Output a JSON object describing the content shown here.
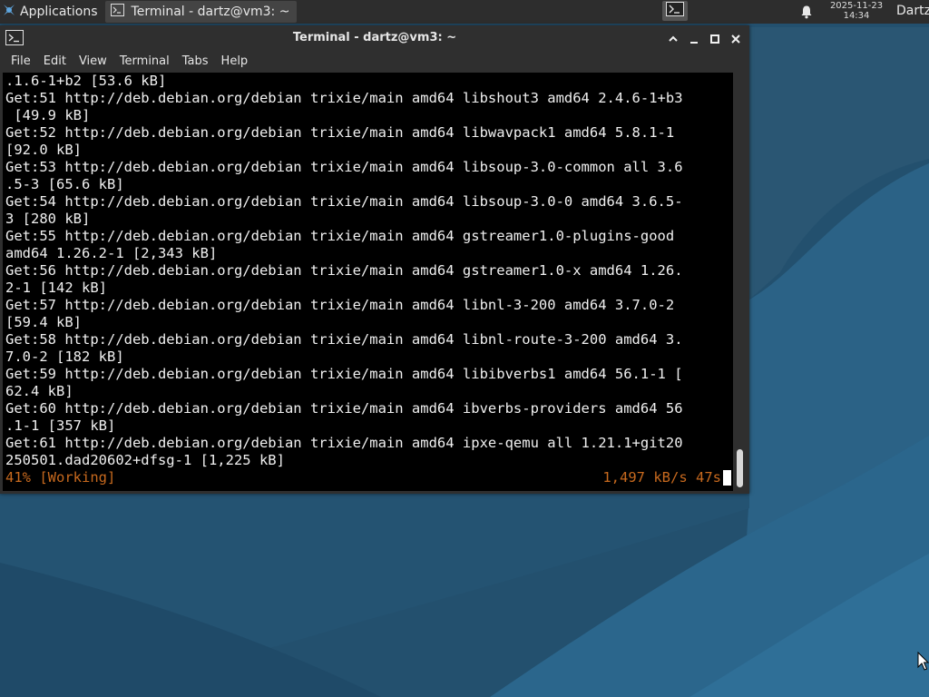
{
  "panel": {
    "app_menu_label": "Applications",
    "task_label": "Terminal - dartz@vm3: ~",
    "clock_date": "2025-11-23",
    "clock_time": "14:34",
    "user_label": "Dartz",
    "icons": {
      "app_menu": "xfce-mouse-icon",
      "task": "terminal-icon",
      "launcher": "terminal-icon",
      "notifications": "bell-icon"
    }
  },
  "window": {
    "title": "Terminal - dartz@vm3: ~",
    "icons": [
      "terminal-icon",
      "chevron-up-icon",
      "minimize-icon",
      "maximize-icon",
      "close-icon"
    ],
    "menu": [
      "File",
      "Edit",
      "View",
      "Terminal",
      "Tabs",
      "Help"
    ]
  },
  "terminal": {
    "lines": [
      ".1.6-1+b2 [53.6 kB]",
      "Get:51 http://deb.debian.org/debian trixie/main amd64 libshout3 amd64 2.4.6-1+b3",
      " [49.9 kB]",
      "Get:52 http://deb.debian.org/debian trixie/main amd64 libwavpack1 amd64 5.8.1-1",
      "[92.0 kB]",
      "Get:53 http://deb.debian.org/debian trixie/main amd64 libsoup-3.0-common all 3.6",
      ".5-3 [65.6 kB]",
      "Get:54 http://deb.debian.org/debian trixie/main amd64 libsoup-3.0-0 amd64 3.6.5-",
      "3 [280 kB]",
      "Get:55 http://deb.debian.org/debian trixie/main amd64 gstreamer1.0-plugins-good",
      "amd64 1.26.2-1 [2,343 kB]",
      "Get:56 http://deb.debian.org/debian trixie/main amd64 gstreamer1.0-x amd64 1.26.",
      "2-1 [142 kB]",
      "Get:57 http://deb.debian.org/debian trixie/main amd64 libnl-3-200 amd64 3.7.0-2",
      "[59.4 kB]",
      "Get:58 http://deb.debian.org/debian trixie/main amd64 libnl-route-3-200 amd64 3.",
      "7.0-2 [182 kB]",
      "Get:59 http://deb.debian.org/debian trixie/main amd64 libibverbs1 amd64 56.1-1 [",
      "62.4 kB]",
      "Get:60 http://deb.debian.org/debian trixie/main amd64 ibverbs-providers amd64 56",
      ".1-1 [357 kB]",
      "Get:61 http://deb.debian.org/debian trixie/main amd64 ipxe-qemu all 1.21.1+git20",
      "250501.dad20602+dfsg-1 [1,225 kB]"
    ],
    "status_left": "41% [Working]",
    "status_right": "1,497 kB/s 47s",
    "colors": {
      "background": "#000000",
      "foreground": "#f0f0f0",
      "status": "#c7691e"
    }
  },
  "colors": {
    "panel": "#2d2d2d",
    "window_chrome": "#2f2f2f",
    "desktop": "#22506f"
  }
}
